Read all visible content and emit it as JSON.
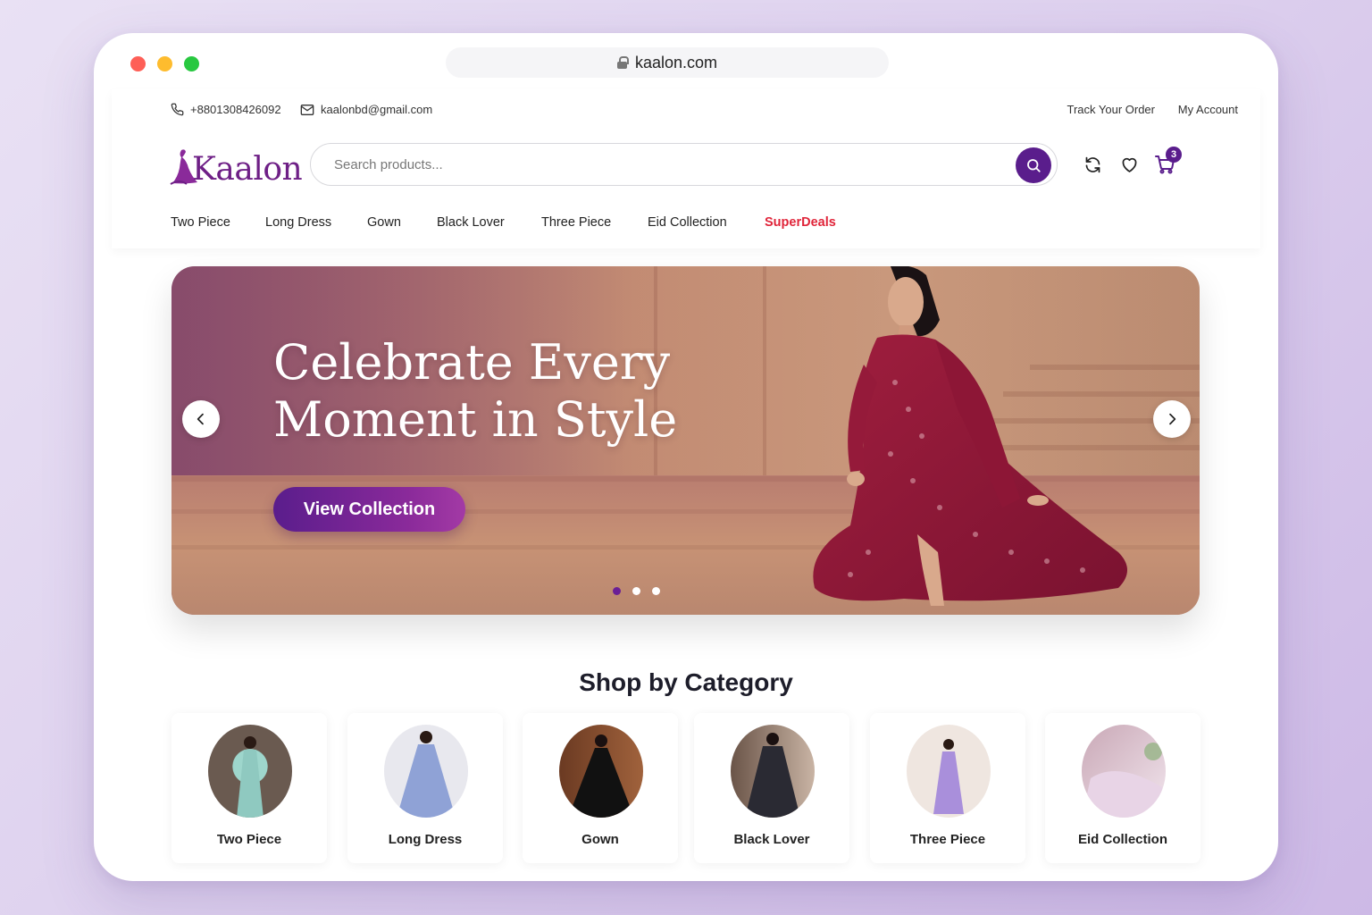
{
  "browser": {
    "url": "kaalon.com"
  },
  "topbar": {
    "phone": "+8801308426092",
    "email": "kaalonbd@gmail.com",
    "track_order": "Track Your Order",
    "my_account": "My Account"
  },
  "header": {
    "logo": "Kaalon",
    "search_placeholder": "Search products...",
    "cart_count": "3"
  },
  "nav": {
    "items": [
      "Two Piece",
      "Long Dress",
      "Gown",
      "Black Lover",
      "Three Piece",
      "Eid Collection",
      "SuperDeals"
    ]
  },
  "hero": {
    "title_line1": "Celebrate Every",
    "title_line2": "Moment in Style",
    "cta": "View Collection",
    "slides": 3,
    "active_slide": 1
  },
  "categories": {
    "title": "Shop by Category",
    "items": [
      {
        "label": "Two Piece",
        "color": "#8fc9c0"
      },
      {
        "label": "Long Dress",
        "color": "#8fa2d6"
      },
      {
        "label": "Gown",
        "color": "#111111"
      },
      {
        "label": "Black Lover",
        "color": "#2a2a33"
      },
      {
        "label": "Three Piece",
        "color": "#a98fdb"
      },
      {
        "label": "Eid Collection",
        "color": "#e8d4e6"
      }
    ]
  },
  "colors": {
    "brand": "#5a1d8c",
    "deal": "#e0253a"
  }
}
